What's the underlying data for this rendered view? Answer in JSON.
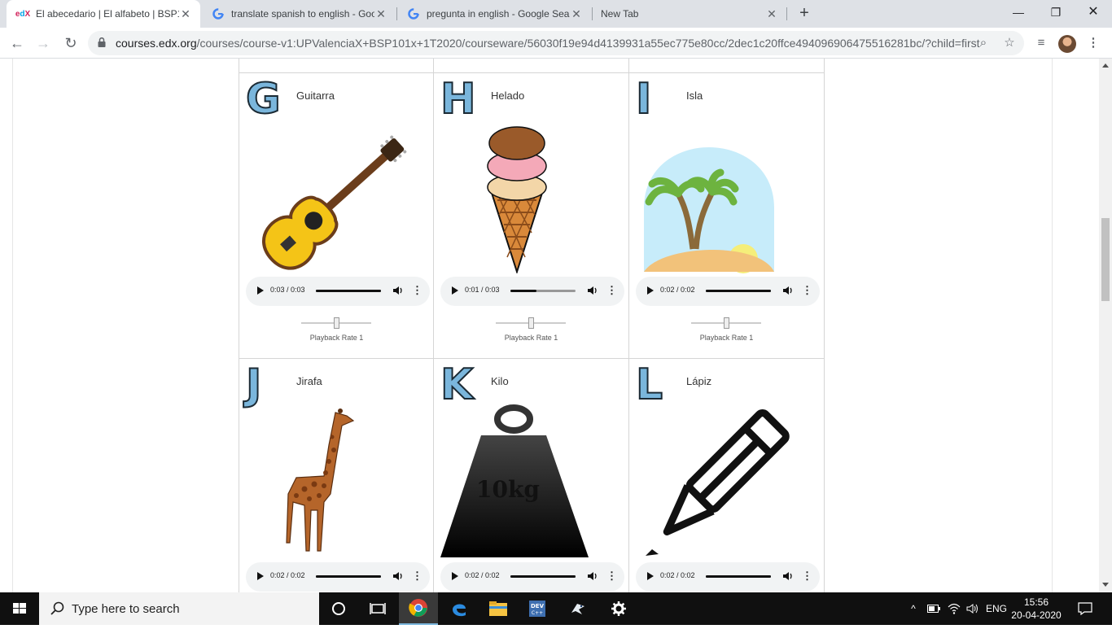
{
  "browser": {
    "tabs": [
      {
        "title": "El abecedario | El alfabeto | BSP10",
        "favicon": "edx-icon",
        "active": true
      },
      {
        "title": "translate spanish to english - Goo",
        "favicon": "google-icon",
        "active": false
      },
      {
        "title": "pregunta in english - Google Sea",
        "favicon": "google-icon",
        "active": false
      },
      {
        "title": "New Tab",
        "favicon": "",
        "active": false
      }
    ],
    "url_host": "courses.edx.org",
    "url_path": "/courses/course-v1:UPValenciaX+BSP101x+1T2020/courseware/56030f19e94d4139931a55ec775e80cc/2dec1c20ffce494096906475516281bc/?child=first"
  },
  "cards": [
    {
      "letter": "G",
      "word": "Guitarra",
      "image": "guitar-image",
      "time": "0:03 / 0:03",
      "progress": 1.0,
      "rate_label": "Playback Rate 1"
    },
    {
      "letter": "H",
      "word": "Helado",
      "image": "ice-cream-image",
      "time": "0:01 / 0:03",
      "progress": 0.4,
      "rate_label": "Playback Rate 1"
    },
    {
      "letter": "I",
      "word": "Isla",
      "image": "island-image",
      "time": "0:02 / 0:02",
      "progress": 1.0,
      "rate_label": "Playback Rate 1"
    },
    {
      "letter": "J",
      "word": "Jirafa",
      "image": "giraffe-image",
      "time": "0:02 / 0:02",
      "progress": 1.0
    },
    {
      "letter": "K",
      "word": "Kilo",
      "image": "weight-image",
      "weight_text": "10kg",
      "time": "0:02 / 0:02",
      "progress": 1.0
    },
    {
      "letter": "L",
      "word": "Lápiz",
      "image": "pencil-image",
      "time": "0:02 / 0:02",
      "progress": 1.0
    }
  ],
  "taskbar": {
    "search_placeholder": "Type here to search",
    "language": "ENG",
    "time": "15:56",
    "date": "20-04-2020"
  },
  "colors": {
    "letter_fill": "#7ab6dc",
    "letter_outline": "#1b2a34",
    "tab_strip": "#dee1e6",
    "taskbar": "#101010"
  }
}
